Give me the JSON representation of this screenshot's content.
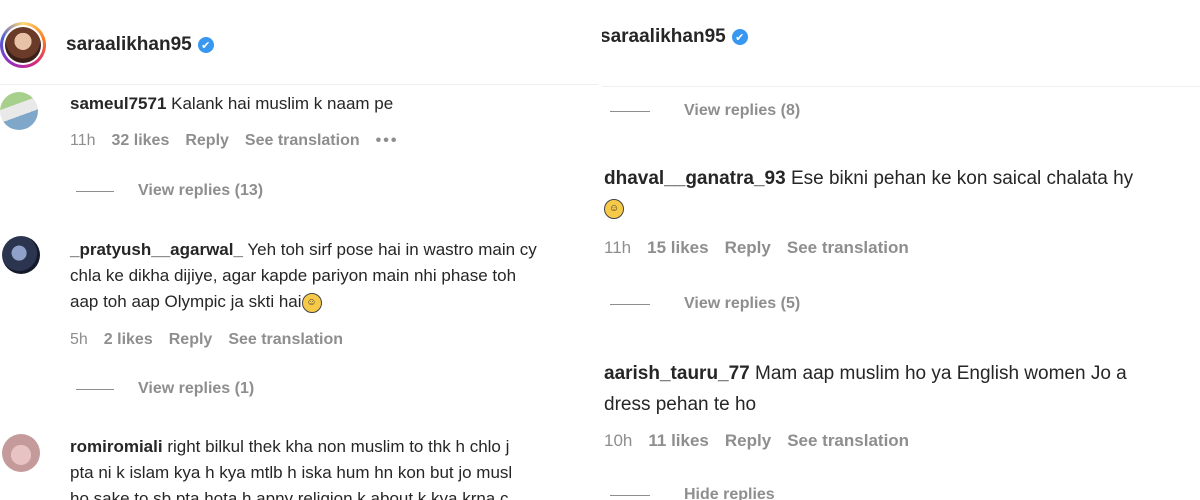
{
  "left": {
    "header": {
      "username": "saraalikhan95",
      "verified_icon": "✔"
    },
    "comments": [
      {
        "username": "sameul7571",
        "text": "Kalank hai muslim k naam pe",
        "time": "11h",
        "likes": "32 likes",
        "reply": "Reply",
        "translate": "See translation",
        "more": "•••",
        "replies": "View replies (13)"
      },
      {
        "username": "_pratyush__agarwal_",
        "lines": [
          "Yeh toh sirf pose hai in wastro main cy",
          "chla ke dikha dijiye, agar kapde pariyon main nhi phase toh",
          "aap toh aap Olympic ja skti hai"
        ],
        "emoji": "😂",
        "time": "5h",
        "likes": "2 likes",
        "reply": "Reply",
        "translate": "See translation",
        "replies": "View replies (1)"
      },
      {
        "username": "romiromiali",
        "lines": [
          "right bilkul thek kha non muslim to thk h chlo j",
          "pta ni k islam kya h kya mtlb h iska hum hn kon but jo musl",
          "ho sake to sb pta hota h apny religion k about k kya krna c"
        ]
      }
    ]
  },
  "right": {
    "header": {
      "username": "saraalikhan95",
      "verified_icon": "✔"
    },
    "top_replies": "View replies (8)",
    "comments": [
      {
        "username": "dhaval__ganatra_93",
        "lines": [
          "Ese bikni pehan ke kon saical chalata hy"
        ],
        "emoji": "😂",
        "time": "11h",
        "likes": "15 likes",
        "reply": "Reply",
        "translate": "See translation",
        "replies": "View replies (5)"
      },
      {
        "username": "aarish_tauru_77",
        "lines": [
          "Mam aap muslim ho ya English women Jo a",
          "dress pehan te ho"
        ],
        "time": "10h",
        "likes": "11 likes",
        "reply": "Reply",
        "translate": "See translation",
        "replies": "Hide replies"
      }
    ]
  }
}
